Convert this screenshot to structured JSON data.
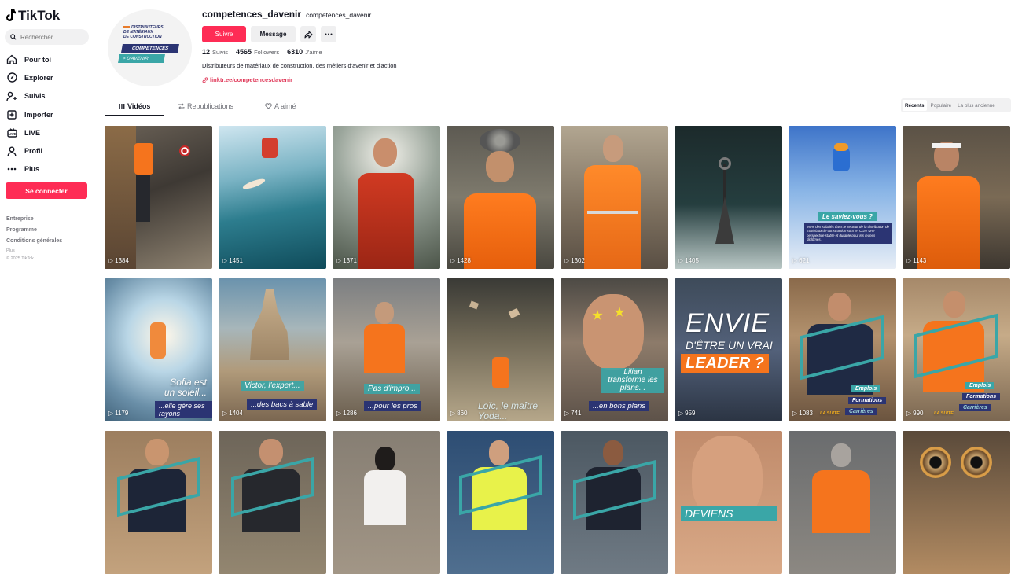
{
  "brand": {
    "name": "TikTok"
  },
  "sidebar": {
    "search_placeholder": "Rechercher",
    "nav": [
      {
        "label": "Pour toi",
        "icon": "home-icon"
      },
      {
        "label": "Explorer",
        "icon": "compass-icon"
      },
      {
        "label": "Suivis",
        "icon": "following-icon"
      },
      {
        "label": "Importer",
        "icon": "upload-icon"
      },
      {
        "label": "LIVE",
        "icon": "live-icon"
      },
      {
        "label": "Profil",
        "icon": "profile-icon"
      },
      {
        "label": "Plus",
        "icon": "more-icon"
      }
    ],
    "login": "Se connecter",
    "footer_links": [
      "Entreprise",
      "Programme",
      "Conditions générales"
    ],
    "footer_more": "Plus",
    "copyright": "© 2025 TikTok"
  },
  "profile": {
    "avatar_text": {
      "line1": "DISTRIBUTEURS",
      "line2": "DE MATÉRIAUX",
      "line3": "DE CONSTRUCTION",
      "badge1": "COMPÉTENCES",
      "badge2": "> D'AVENIR"
    },
    "username": "competences_davenir",
    "nickname": "competences_davenir",
    "follow": "Suivre",
    "message": "Message",
    "stats": {
      "following": "12",
      "following_label": "Suivis",
      "followers": "4565",
      "followers_label": "Followers",
      "likes": "6310",
      "likes_label": "J'aime"
    },
    "bio": "Distributeurs de matériaux de construction, des métiers d'avenir et d'action",
    "link": "linktr.ee/competencesdavenir"
  },
  "tabs": [
    "Vidéos",
    "Republications",
    "A aimé"
  ],
  "sort": [
    "Récents",
    "Populaire",
    "La plus ancienne"
  ],
  "videos": [
    {
      "views": "1384"
    },
    {
      "views": "1451"
    },
    {
      "views": "1371"
    },
    {
      "views": "1428"
    },
    {
      "views": "1302"
    },
    {
      "views": "1405"
    },
    {
      "views": "621",
      "title": "Le saviez-vous ?",
      "text": "95 % des salariés dans le secteur de la distribution de matériaux de construction sont en CDI ! Une perspective stable et durable pour les jeunes diplômés."
    },
    {
      "views": "1143"
    },
    {
      "views": "1179",
      "title": "Sofia est un soleil...",
      "sub": "...elle gère ses rayons"
    },
    {
      "views": "1404",
      "title": "Victor, l'expert...",
      "sub": "...des bacs à sable"
    },
    {
      "views": "1286",
      "title": "Pas d'impro...",
      "sub": "...pour les pros"
    },
    {
      "views": "860",
      "title": "Loïc, le maître Yoda..."
    },
    {
      "views": "741",
      "title": "Lilian transforme les plans...",
      "sub": "...en bons plans"
    },
    {
      "views": "959",
      "title": "ENVIE",
      "sub": "D'ÊTRE UN VRAI",
      "tag": "LEADER ?"
    },
    {
      "views": "1083",
      "items": [
        "Emplois",
        "Formations",
        "Carrières"
      ],
      "tag": "LA SUITE"
    },
    {
      "views": "990",
      "items": [
        "Emplois",
        "Formations",
        "Carrières"
      ],
      "tag": "LA SUITE"
    },
    {},
    {},
    {},
    {},
    {},
    {
      "title": "DEVIENS"
    },
    {},
    {}
  ],
  "colors": {
    "accent": "#fe2c55",
    "teal": "#3aa6a7",
    "navy": "#2b3473",
    "orange": "#f5741d"
  }
}
